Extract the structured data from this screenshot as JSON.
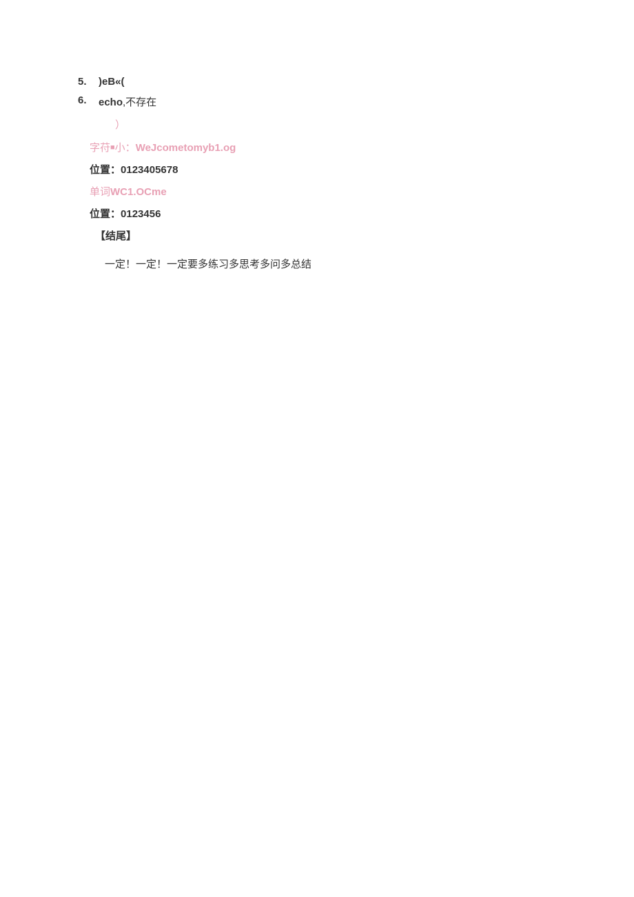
{
  "items": [
    {
      "number": "5.",
      "text_bold": ")eB«("
    },
    {
      "number": "6.",
      "text_bold": "echo",
      "text_normal": ",不存在"
    }
  ],
  "lines": {
    "paren": "）",
    "charstr_label": "字苻",
    "charstr_small": "■",
    "charstr_label2": "小：",
    "charstr_value": "WeJcometomyb1.og",
    "pos1_label": "位置：",
    "pos1_value": "0123405678",
    "word_label": "单词",
    "word_value": "WC1.OCme",
    "pos2_label": "位置：",
    "pos2_value": "0123456",
    "end_marker": "【结尾】",
    "final": "一定！一定！一定要多练习多思考多问多总结"
  }
}
